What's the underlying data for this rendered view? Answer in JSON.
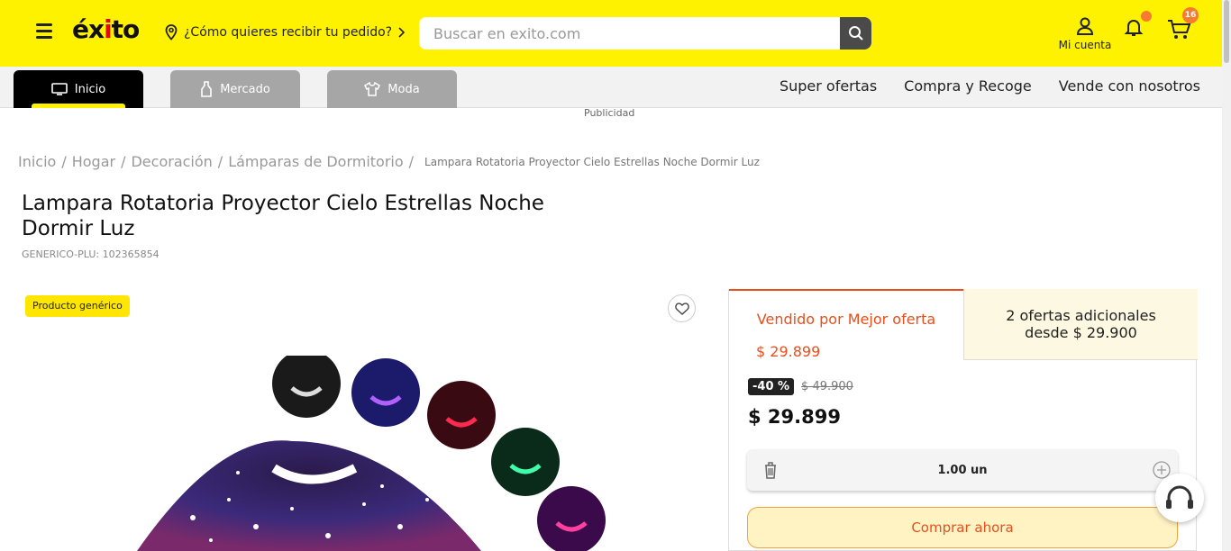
{
  "header": {
    "logo": "éxito",
    "location_prompt": "¿Cómo quieres recibir tu pedido?",
    "search_placeholder": "Buscar en exito.com",
    "account_label": "Mi cuenta",
    "cart_count": "16",
    "brand_color": "#fff200",
    "accent_color": "#f47b30"
  },
  "nav": {
    "tabs": [
      {
        "label": "Inicio",
        "icon": "monitor-icon",
        "active": true
      },
      {
        "label": "Mercado",
        "icon": "bottle-icon",
        "active": false
      },
      {
        "label": "Moda",
        "icon": "shirt-icon",
        "active": false
      }
    ],
    "links": [
      "Super ofertas",
      "Compra y Recoge",
      "Vende con nosotros"
    ],
    "ad_label": "Publicidad"
  },
  "breadcrumb": {
    "items": [
      "Inicio",
      "Hogar",
      "Decoración",
      "Lámparas de Dormitorio"
    ],
    "current": "Lampara Rotatoria Proyector Cielo Estrellas Noche Dormir Luz"
  },
  "product": {
    "title": "Lampara Rotatoria Proyector Cielo Estrellas Noche Dormir Luz",
    "plu": "GENERICO-PLU: 102365854",
    "badge": "Producto genérico"
  },
  "offers": {
    "seller_tab": "Vendido por Mejor oferta",
    "seller_price": "$ 29.899",
    "other_tab": "2 ofertas adicionales desde $ 29.900",
    "discount": "-40 %",
    "old_price": "$ 49.900",
    "price": "$ 29.899",
    "quantity": "1.00 un",
    "buy_label": "Comprar ahora"
  }
}
